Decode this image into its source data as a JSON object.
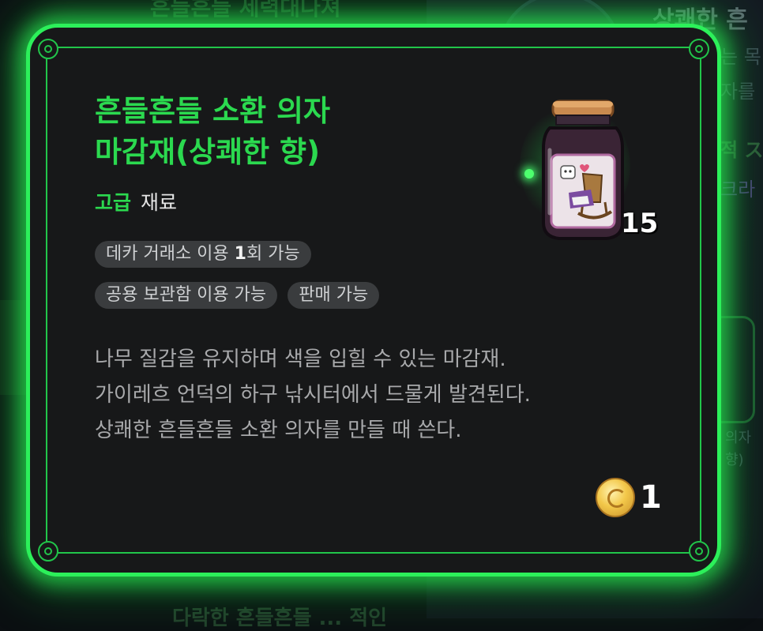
{
  "item": {
    "title_line1": "흔들흔들 소환 의자",
    "title_line2": "마감재(상쾌한 향)",
    "grade": "고급",
    "category": "재료",
    "count": "15",
    "icon": "wood-stain-jar-icon"
  },
  "tags": {
    "trade_prefix": "데카 거래소 이용 ",
    "trade_count": "1",
    "trade_suffix": "회 가능",
    "storage": "공용 보관함 이용 가능",
    "sellable": "판매 가능"
  },
  "description": [
    "나무 질감을 유지하며 색을 입힐 수 있는 마감재.",
    "가이레흐 언덕의 하구 낚시터에서 드물게 발견된다.",
    "상쾌한 흔들흔들 소환 의자를 만들 때 쓴다."
  ],
  "price": {
    "value": "1",
    "icon": "gold-coin-icon"
  },
  "colors": {
    "accent_green": "#2bd94f",
    "card_background": "#171819",
    "tag_background": "#3a3c3e",
    "description_text": "#a8a9ab"
  }
}
